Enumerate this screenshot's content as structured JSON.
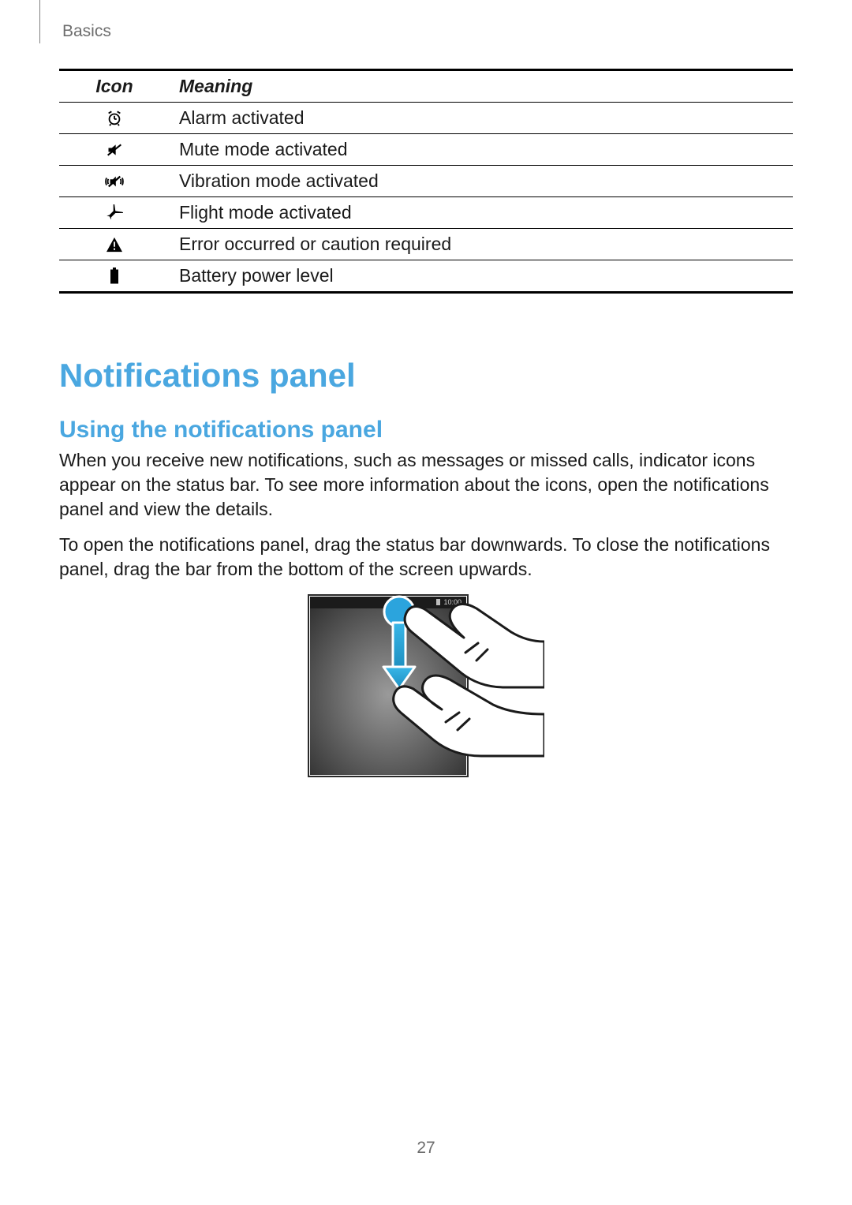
{
  "breadcrumb": "Basics",
  "table": {
    "headers": {
      "icon": "Icon",
      "meaning": "Meaning"
    },
    "rows": [
      {
        "icon_name": "alarm-icon",
        "meaning": "Alarm activated"
      },
      {
        "icon_name": "mute-icon",
        "meaning": "Mute mode activated"
      },
      {
        "icon_name": "vibration-icon",
        "meaning": "Vibration mode activated"
      },
      {
        "icon_name": "flight-mode-icon",
        "meaning": "Flight mode activated"
      },
      {
        "icon_name": "warning-icon",
        "meaning": "Error occurred or caution required"
      },
      {
        "icon_name": "battery-icon",
        "meaning": "Battery power level"
      }
    ]
  },
  "heading": "Notifications panel",
  "subheading": "Using the notifications panel",
  "paragraph1": "When you receive new notifications, such as messages or missed calls, indicator icons appear on the status bar. To see more information about the icons, open the notifications panel and view the details.",
  "paragraph2": "To open the notifications panel, drag the status bar downwards. To close the notifications panel, drag the bar from the bottom of the screen upwards.",
  "illustration": {
    "status_time": "10:00",
    "description": "Hand dragging status bar downward"
  },
  "page_number": "27"
}
